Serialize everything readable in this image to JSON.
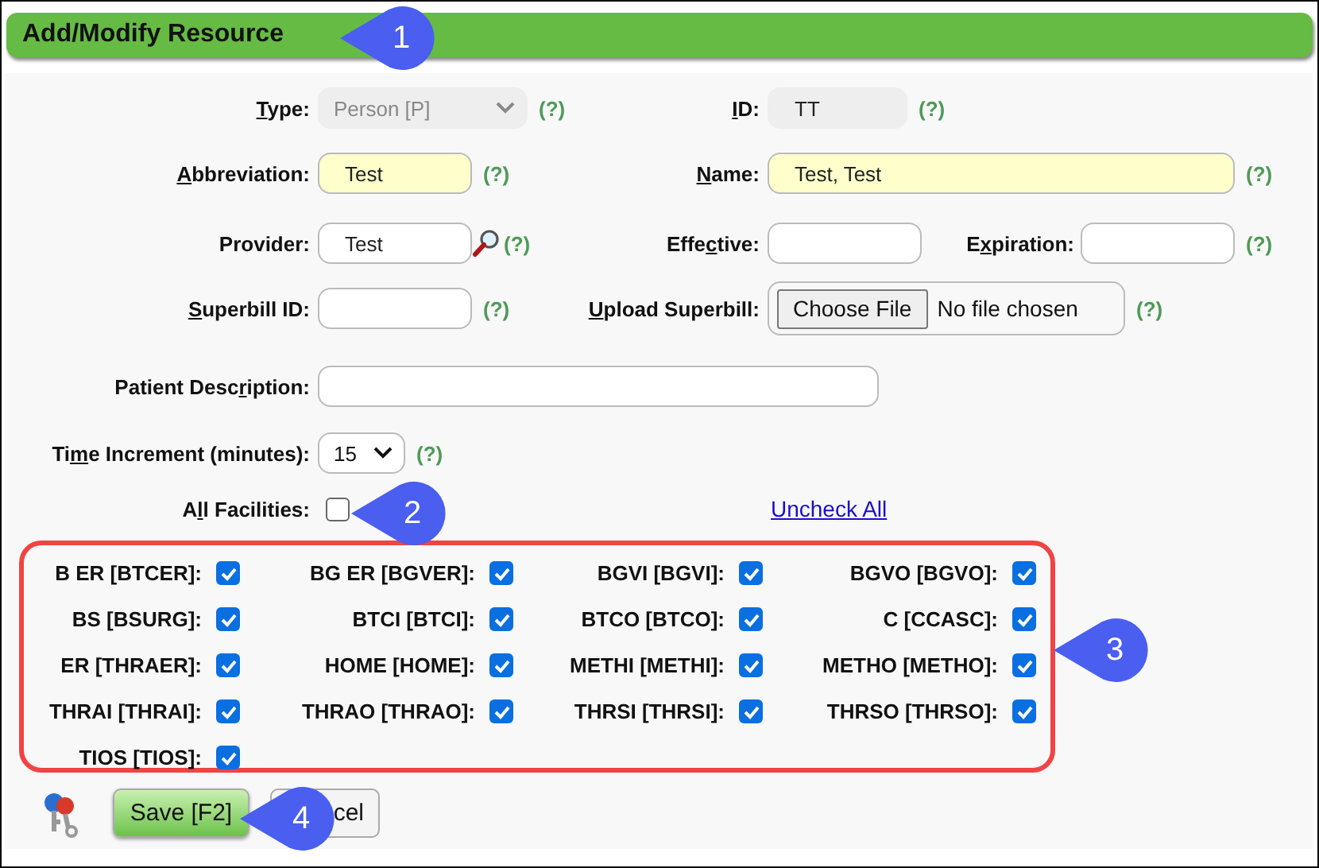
{
  "header": {
    "title": "Add/Modify Resource"
  },
  "form": {
    "type": {
      "label": [
        {
          "text": "T",
          "key": true
        },
        {
          "text": "ype:",
          "key": false
        }
      ],
      "value": "Person [P]",
      "disabled": true,
      "help": "(?)"
    },
    "id": {
      "label": [
        {
          "text": "I",
          "key": true
        },
        {
          "text": "D:",
          "key": false
        }
      ],
      "value": "TT",
      "readonly": true,
      "help": "(?)"
    },
    "abbreviation": {
      "label": [
        {
          "text": "A",
          "key": true
        },
        {
          "text": "bbreviation:",
          "key": false
        }
      ],
      "value": "Test",
      "required": true,
      "help": "(?)"
    },
    "name": {
      "label": [
        {
          "text": "N",
          "key": true
        },
        {
          "text": "ame:",
          "key": false
        }
      ],
      "value": "Test, Test",
      "required": true,
      "help": "(?)"
    },
    "provider": {
      "label": [
        {
          "text": "Provider:",
          "key": false
        }
      ],
      "value": "Test",
      "required": false,
      "help": "(?)"
    },
    "effective": {
      "label": [
        {
          "text": "Effe",
          "key": false
        },
        {
          "text": "c",
          "key": true
        },
        {
          "text": "tive:",
          "key": false
        }
      ]
    },
    "expiration": {
      "label": [
        {
          "text": "E",
          "key": false
        },
        {
          "text": "x",
          "key": true
        },
        {
          "text": "piration:",
          "key": false
        }
      ],
      "help": "(?)"
    },
    "superbill_id": {
      "label": [
        {
          "text": "S",
          "key": true
        },
        {
          "text": "uperbill ID:",
          "key": false
        }
      ],
      "help": "(?)"
    },
    "upload_superbill": {
      "label": [
        {
          "text": "U",
          "key": true
        },
        {
          "text": "pload Superbill:",
          "key": false
        }
      ],
      "button": "Choose File",
      "status": "No file chosen",
      "help": "(?)"
    },
    "patient_description": {
      "label": [
        {
          "text": "Patient Desc",
          "key": false
        },
        {
          "text": "r",
          "key": true
        },
        {
          "text": "iption:",
          "key": false
        }
      ]
    },
    "time_increment": {
      "label": [
        {
          "text": "Ti",
          "key": false
        },
        {
          "text": "m",
          "key": true
        },
        {
          "text": "e Increment (minutes):",
          "key": false
        }
      ],
      "value": "15",
      "help": "(?)"
    },
    "all_facilities": {
      "label": [
        {
          "text": "A",
          "key": false
        },
        {
          "text": "l",
          "key": true
        },
        {
          "text": "l Facilities:",
          "key": false
        }
      ],
      "checked": false
    },
    "uncheck_all": "Uncheck All"
  },
  "facilities": [
    {
      "label": "B ER [BTCER]:",
      "checked": true
    },
    {
      "label": "BG ER [BGVER]:",
      "checked": true
    },
    {
      "label": "BGVI [BGVI]:",
      "checked": true
    },
    {
      "label": "BGVO [BGVO]:",
      "checked": true
    },
    {
      "label": "BS [BSURG]:",
      "checked": true
    },
    {
      "label": "BTCI [BTCI]:",
      "checked": true
    },
    {
      "label": "BTCO [BTCO]:",
      "checked": true
    },
    {
      "label": "C [CCASC]:",
      "checked": true
    },
    {
      "label": "ER [THRAER]:",
      "checked": true
    },
    {
      "label": "HOME [HOME]:",
      "checked": true
    },
    {
      "label": "METHI [METHI]:",
      "checked": true
    },
    {
      "label": "METHO [METHO]:",
      "checked": true
    },
    {
      "label": "THRAI [THRAI]:",
      "checked": true
    },
    {
      "label": "THRAO [THRAO]:",
      "checked": true
    },
    {
      "label": "THRSI [THRSI]:",
      "checked": true
    },
    {
      "label": "THRSO [THRSO]:",
      "checked": true
    },
    {
      "label": "TIOS [TIOS]:",
      "checked": true
    }
  ],
  "buttons": {
    "save": "Save [F2]",
    "cancel": "cel"
  },
  "callouts": [
    {
      "text": "1"
    },
    {
      "text": "2"
    },
    {
      "text": "3"
    },
    {
      "text": "4"
    }
  ]
}
